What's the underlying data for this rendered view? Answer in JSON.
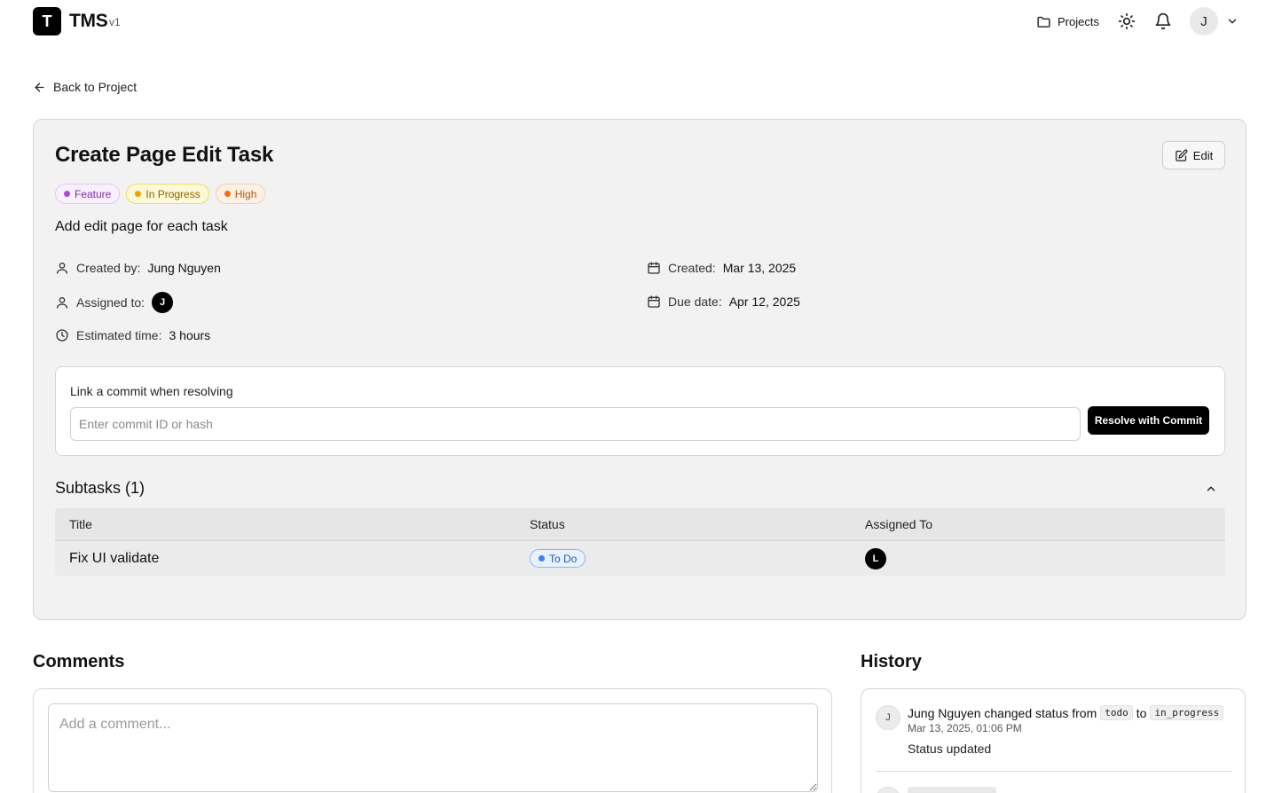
{
  "app": {
    "logo_letter": "T",
    "name": "TMS",
    "version": "v1"
  },
  "header": {
    "projects_label": "Projects",
    "user_initial": "J"
  },
  "back_link": "Back to Project",
  "task": {
    "title": "Create Page Edit Task",
    "edit_label": "Edit",
    "badges": [
      {
        "label": "Feature",
        "color": "#a64bd8"
      },
      {
        "label": "In Progress",
        "color": "#e8a800"
      },
      {
        "label": "High",
        "color": "#ec6e1c"
      }
    ],
    "description": "Add edit page for each task",
    "created_by_label": "Created by:",
    "created_by": "Jung Nguyen",
    "assigned_to_label": "Assigned to:",
    "assigned_to_initial": "J",
    "estimated_label": "Estimated time:",
    "estimated": "3 hours",
    "created_label": "Created:",
    "created": "Mar 13, 2025",
    "due_label": "Due date:",
    "due": "Apr 12, 2025"
  },
  "commit": {
    "label": "Link a commit when resolving",
    "placeholder": "Enter commit ID or hash",
    "button": "Resolve with Commit"
  },
  "subtasks": {
    "heading": "Subtasks (1)",
    "columns": [
      "Title",
      "Status",
      "Assigned To"
    ],
    "rows": [
      {
        "title": "Fix UI validate",
        "status": "To Do",
        "assignee_initial": "L"
      }
    ]
  },
  "comments": {
    "heading": "Comments",
    "placeholder": "Add a comment..."
  },
  "history": {
    "heading": "History",
    "entries": [
      {
        "initial": "J",
        "text": "Jung Nguyen changed status from",
        "from": "todo",
        "to_word": "to",
        "to": "in_progress",
        "time": "Mar 13, 2025, 01:06 PM",
        "message": "Status updated"
      }
    ]
  }
}
